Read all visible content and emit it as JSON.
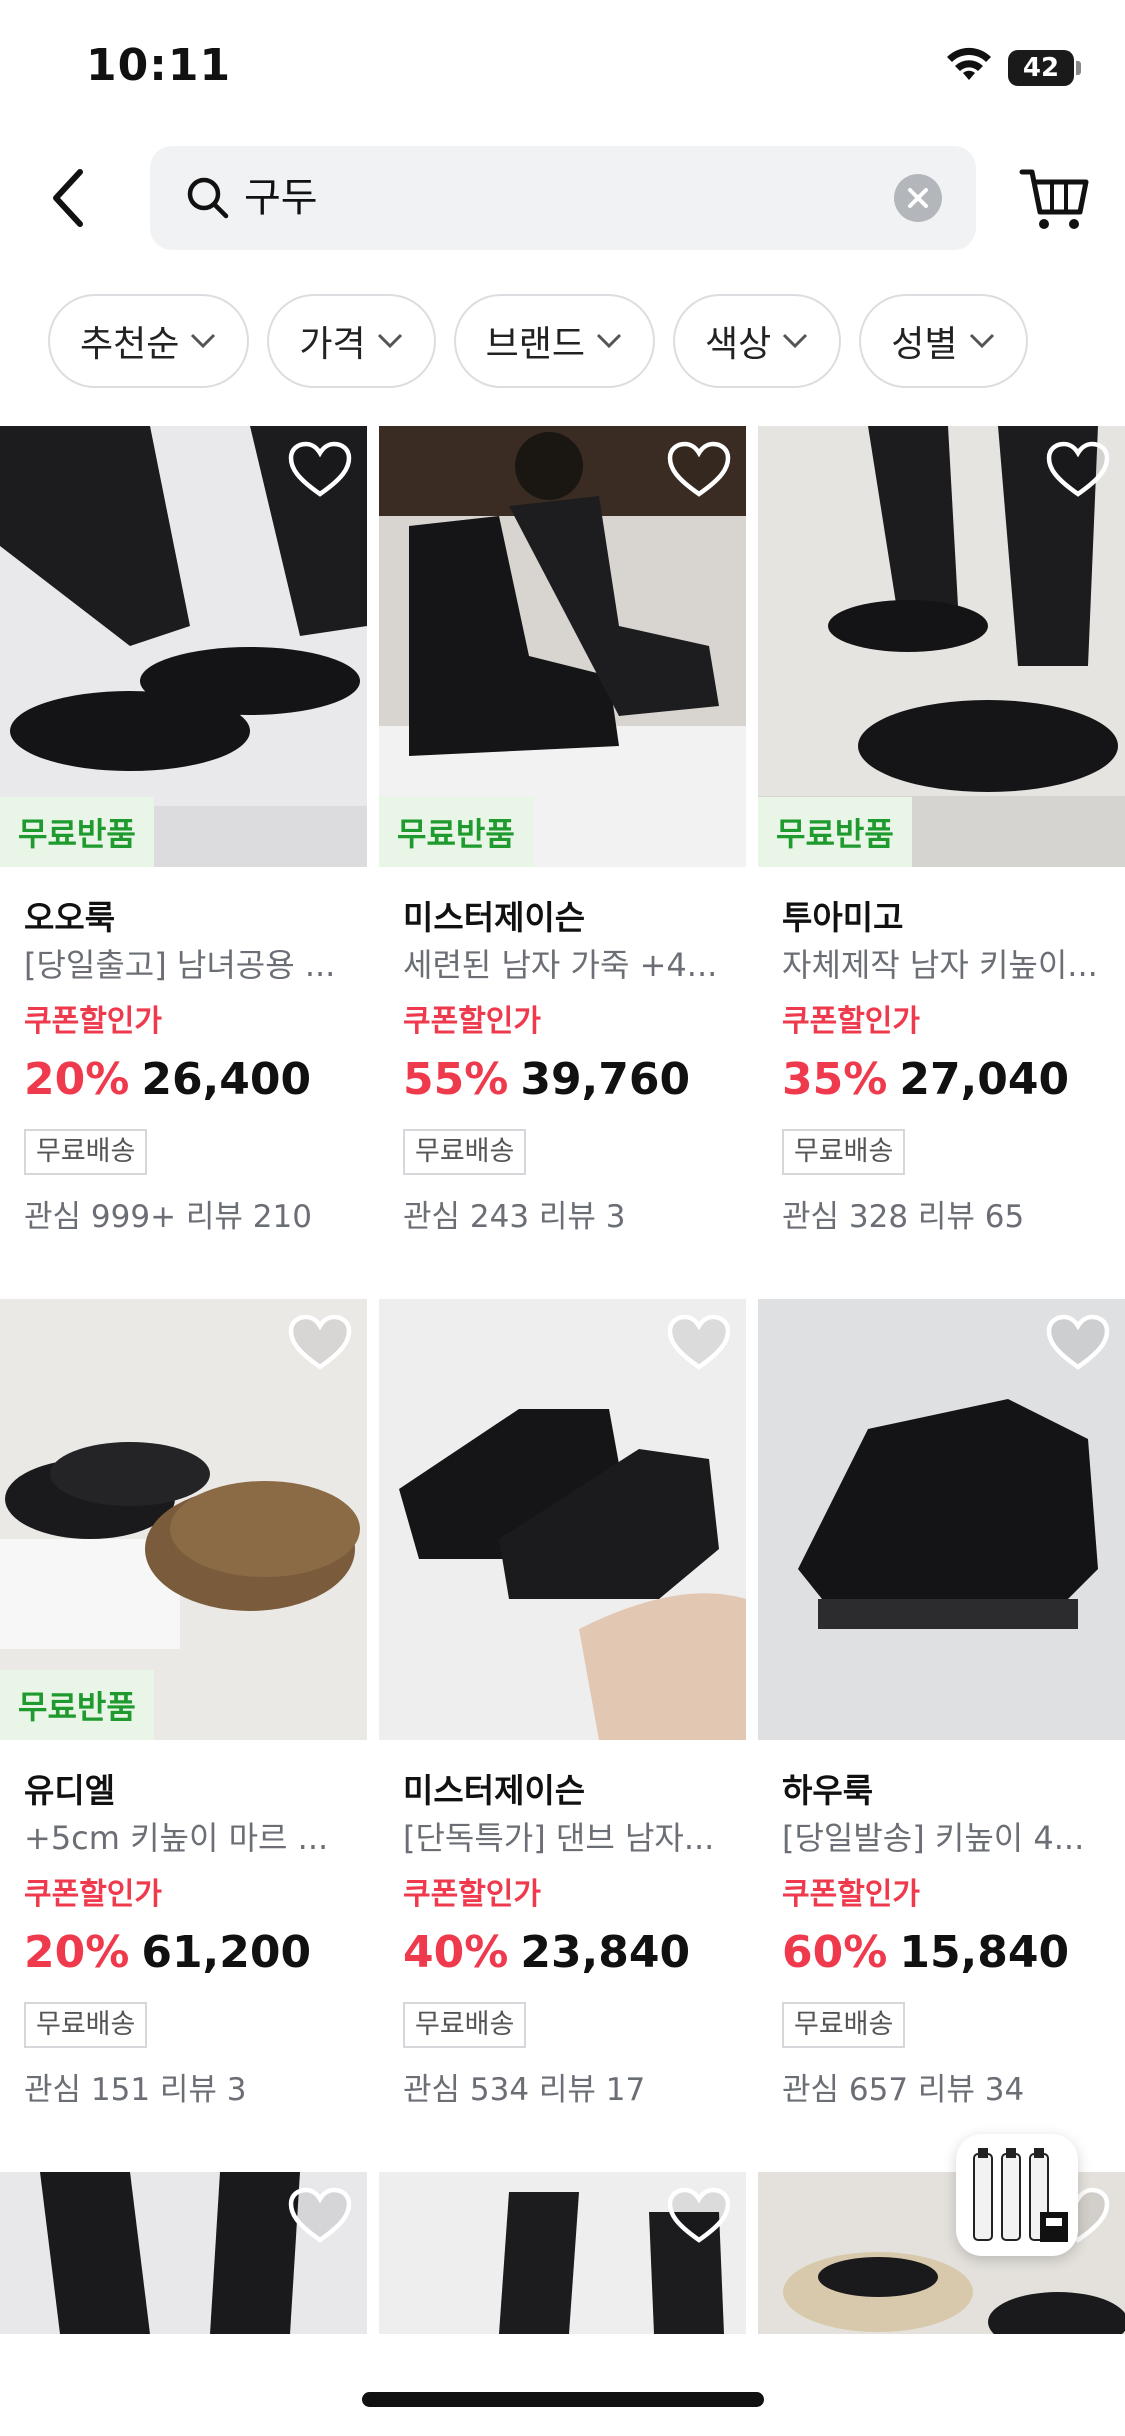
{
  "status_bar": {
    "time": "10:11",
    "battery": "42"
  },
  "search": {
    "query": "구두"
  },
  "filters": [
    {
      "label": "추천순"
    },
    {
      "label": "가격"
    },
    {
      "label": "브랜드"
    },
    {
      "label": "색상"
    },
    {
      "label": "성별"
    }
  ],
  "products": [
    {
      "brand": "오오룩",
      "name": "[당일출고] 남녀공용 ...",
      "coupon_label": "쿠폰할인가",
      "discount": "20%",
      "price": "26,400",
      "shipping": "무료배송",
      "stats": "관심 999+ 리뷰 210",
      "badge": "무료반품"
    },
    {
      "brand": "미스터제이슨",
      "name": "세련된 남자 가죽 +4...",
      "coupon_label": "쿠폰할인가",
      "discount": "55%",
      "price": "39,760",
      "shipping": "무료배송",
      "stats": "관심 243 리뷰 3",
      "badge": "무료반품"
    },
    {
      "brand": "투아미고",
      "name": "자체제작 남자 키높이...",
      "coupon_label": "쿠폰할인가",
      "discount": "35%",
      "price": "27,040",
      "shipping": "무료배송",
      "stats": "관심 328 리뷰 65",
      "badge": "무료반품"
    },
    {
      "brand": "유디엘",
      "name": "+5cm 키높이 마르 ...",
      "coupon_label": "쿠폰할인가",
      "discount": "20%",
      "price": "61,200",
      "shipping": "무료배송",
      "stats": "관심 151 리뷰 3",
      "badge": "무료반품"
    },
    {
      "brand": "미스터제이슨",
      "name": "[단독특가] 댄브 남자...",
      "coupon_label": "쿠폰할인가",
      "discount": "40%",
      "price": "23,840",
      "shipping": "무료배송",
      "stats": "관심 534 리뷰 17",
      "badge": ""
    },
    {
      "brand": "하우룩",
      "name": "[당일발송] 키높이 4...",
      "coupon_label": "쿠폰할인가",
      "discount": "60%",
      "price": "15,840",
      "shipping": "무료배송",
      "stats": "관심 657 리뷰 34",
      "badge": ""
    }
  ],
  "colors": {
    "accent_red": "#ee3a4c",
    "badge_green": "#1f9a2e",
    "badge_bg": "#e9f6e7"
  },
  "icons": [
    "back-icon",
    "search-icon",
    "clear-icon",
    "cart-icon",
    "heart-icon",
    "chevron-down-icon",
    "wifi-icon",
    "gift-icon"
  ]
}
